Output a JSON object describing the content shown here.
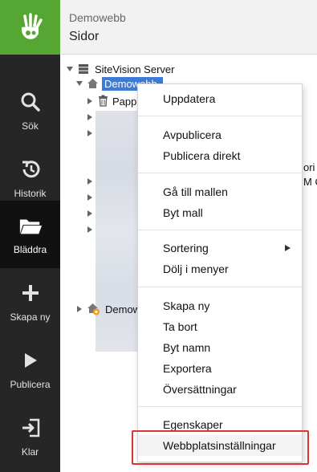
{
  "header": {
    "site_name": "Demowebb",
    "section": "Sidor"
  },
  "sidebar": {
    "items": [
      {
        "id": "search",
        "label": "Sök",
        "icon": "search-icon"
      },
      {
        "id": "history",
        "label": "Historik",
        "icon": "history-icon"
      },
      {
        "id": "browse",
        "label": "Bläddra",
        "icon": "folder-icon",
        "active": true
      },
      {
        "id": "create",
        "label": "Skapa ny",
        "icon": "plus-icon"
      },
      {
        "id": "publish",
        "label": "Publicera",
        "icon": "play-icon"
      },
      {
        "id": "done",
        "label": "Klar",
        "icon": "exit-icon"
      }
    ]
  },
  "tree": {
    "root": "SiteVision Server",
    "site_selected": "Demowebb",
    "trash_partial": "Papp",
    "site2_partial": "Demow",
    "clipped_text_1": "ori",
    "clipped_text_2": "M O"
  },
  "context_menu": {
    "update": "Uppdatera",
    "unpublish": "Avpublicera",
    "publish_now": "Publicera direkt",
    "goto_template": "Gå till mallen",
    "change_template": "Byt mall",
    "sorting": "Sortering",
    "hide_in_menus": "Dölj i menyer",
    "create_new": "Skapa ny",
    "delete": "Ta bort",
    "rename": "Byt namn",
    "export": "Exportera",
    "translations": "Översättningar",
    "properties": "Egenskaper",
    "site_settings": "Webbplatsinställningar"
  },
  "colors": {
    "brand_green": "#55a632",
    "rail_bg": "#262626",
    "rail_active": "#111111",
    "selection_blue": "#3d7bd6",
    "highlight_red": "#dd3333"
  }
}
